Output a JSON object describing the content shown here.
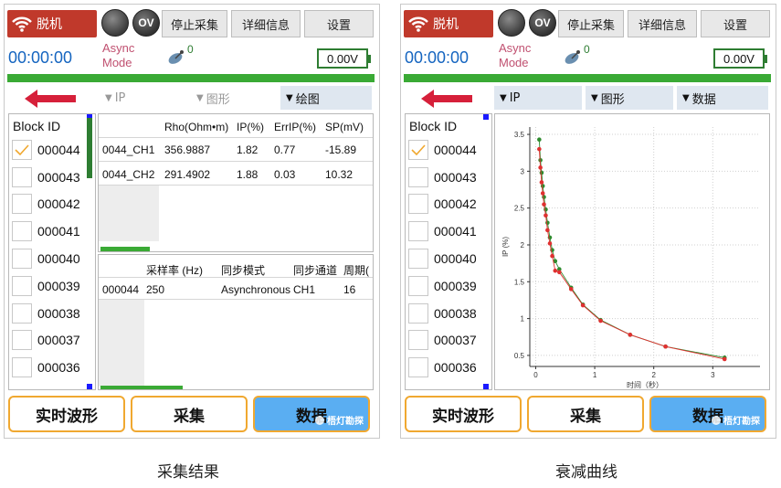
{
  "screens": [
    {
      "status": {
        "connection_label": "脱机",
        "ov_label": "OV",
        "stop_label": "停止采集",
        "details_label": "详细信息",
        "settings_label": "设置"
      },
      "timer": "00:00:00",
      "mode": {
        "line1": "Async",
        "line2": "Mode"
      },
      "satellite_count": "0",
      "voltage": "0.00V",
      "filters": [
        {
          "label": "IP",
          "state": "collapsed"
        },
        {
          "label": "图形",
          "state": "collapsed"
        },
        {
          "label": "绘图",
          "state": "active"
        }
      ],
      "block_list": {
        "header": "Block ID",
        "items": [
          {
            "id": "000044",
            "checked": true
          },
          {
            "id": "000043"
          },
          {
            "id": "000042"
          },
          {
            "id": "000041"
          },
          {
            "id": "000040"
          },
          {
            "id": "000039"
          },
          {
            "id": "000038"
          },
          {
            "id": "000037"
          },
          {
            "id": "000036"
          }
        ]
      },
      "results_table": {
        "headers": [
          "",
          "Rho(Ohm•m)",
          "IP(%)",
          "ErrIP(%)",
          "SP(mV)"
        ],
        "rows": [
          [
            "0044_CH1",
            "356.9887",
            "1.82",
            "0.77",
            "-15.89"
          ],
          [
            "0044_CH2",
            "291.4902",
            "1.88",
            "0.03",
            "10.32"
          ]
        ]
      },
      "info_table": {
        "headers": [
          "",
          "采样率 (Hz)",
          "同步模式",
          "同步通道",
          "周期("
        ],
        "rows": [
          [
            "000044",
            "250",
            "Asynchronous",
            "CH1",
            "16"
          ]
        ]
      },
      "bottom": {
        "waveform_label": "实时波形",
        "acquire_label": "采集",
        "data_label": "数据",
        "watermark": "梧灯勘探"
      },
      "caption": "采集结果"
    },
    {
      "status": {
        "connection_label": "脱机",
        "ov_label": "OV",
        "stop_label": "停止采集",
        "details_label": "详细信息",
        "settings_label": "设置"
      },
      "timer": "00:00:00",
      "mode": {
        "line1": "Async",
        "line2": "Mode"
      },
      "satellite_count": "0",
      "voltage": "0.00V",
      "filters": [
        {
          "label": "IP",
          "state": "active"
        },
        {
          "label": "图形",
          "state": "active"
        },
        {
          "label": "数据",
          "state": "active"
        }
      ],
      "block_list": {
        "header": "Block ID",
        "items": [
          {
            "id": "000044",
            "checked": true
          },
          {
            "id": "000043"
          },
          {
            "id": "000042"
          },
          {
            "id": "000041"
          },
          {
            "id": "000040"
          },
          {
            "id": "000039"
          },
          {
            "id": "000038"
          },
          {
            "id": "000037"
          },
          {
            "id": "000036"
          }
        ]
      },
      "bottom": {
        "waveform_label": "实时波形",
        "acquire_label": "采集",
        "data_label": "数据",
        "watermark": "梧灯勘探"
      },
      "caption": "衰减曲线"
    }
  ],
  "chart_data": {
    "type": "line",
    "xlabel": "时间（秒）",
    "ylabel": "IP (%)",
    "xlim": [
      -0.1,
      3.8
    ],
    "ylim": [
      0.35,
      3.6
    ],
    "xticks": [
      0,
      1,
      2,
      3
    ],
    "yticks": [
      0.5,
      1,
      1.5,
      2,
      2.5,
      3,
      3.5
    ],
    "grid": true,
    "series": [
      {
        "color": "#2e8b2e",
        "x": [
          0.06,
          0.08,
          0.1,
          0.12,
          0.14,
          0.17,
          0.2,
          0.24,
          0.28,
          0.33,
          0.4,
          0.6,
          0.8,
          1.1,
          1.6,
          2.2,
          3.2
        ],
        "values": [
          3.43,
          3.15,
          2.98,
          2.8,
          2.65,
          2.48,
          2.3,
          2.1,
          1.93,
          1.78,
          1.67,
          1.42,
          1.19,
          0.98,
          0.78,
          0.62,
          0.47
        ]
      },
      {
        "color": "#e03030",
        "x": [
          0.06,
          0.08,
          0.1,
          0.12,
          0.14,
          0.17,
          0.2,
          0.24,
          0.28,
          0.33,
          0.4,
          0.6,
          0.8,
          1.1,
          1.6,
          2.2,
          3.2
        ],
        "values": [
          3.3,
          3.05,
          2.85,
          2.7,
          2.55,
          2.4,
          2.2,
          2.02,
          1.85,
          1.65,
          1.63,
          1.4,
          1.18,
          0.97,
          0.78,
          0.62,
          0.45
        ]
      }
    ]
  },
  "colors": {
    "status_red": "#c0392b",
    "status_green": "#3aaa35",
    "timer_blue": "#1565c0",
    "mode_pink": "#c05070",
    "selected_button": "#5aaef2",
    "button_border": "#f0a830"
  }
}
